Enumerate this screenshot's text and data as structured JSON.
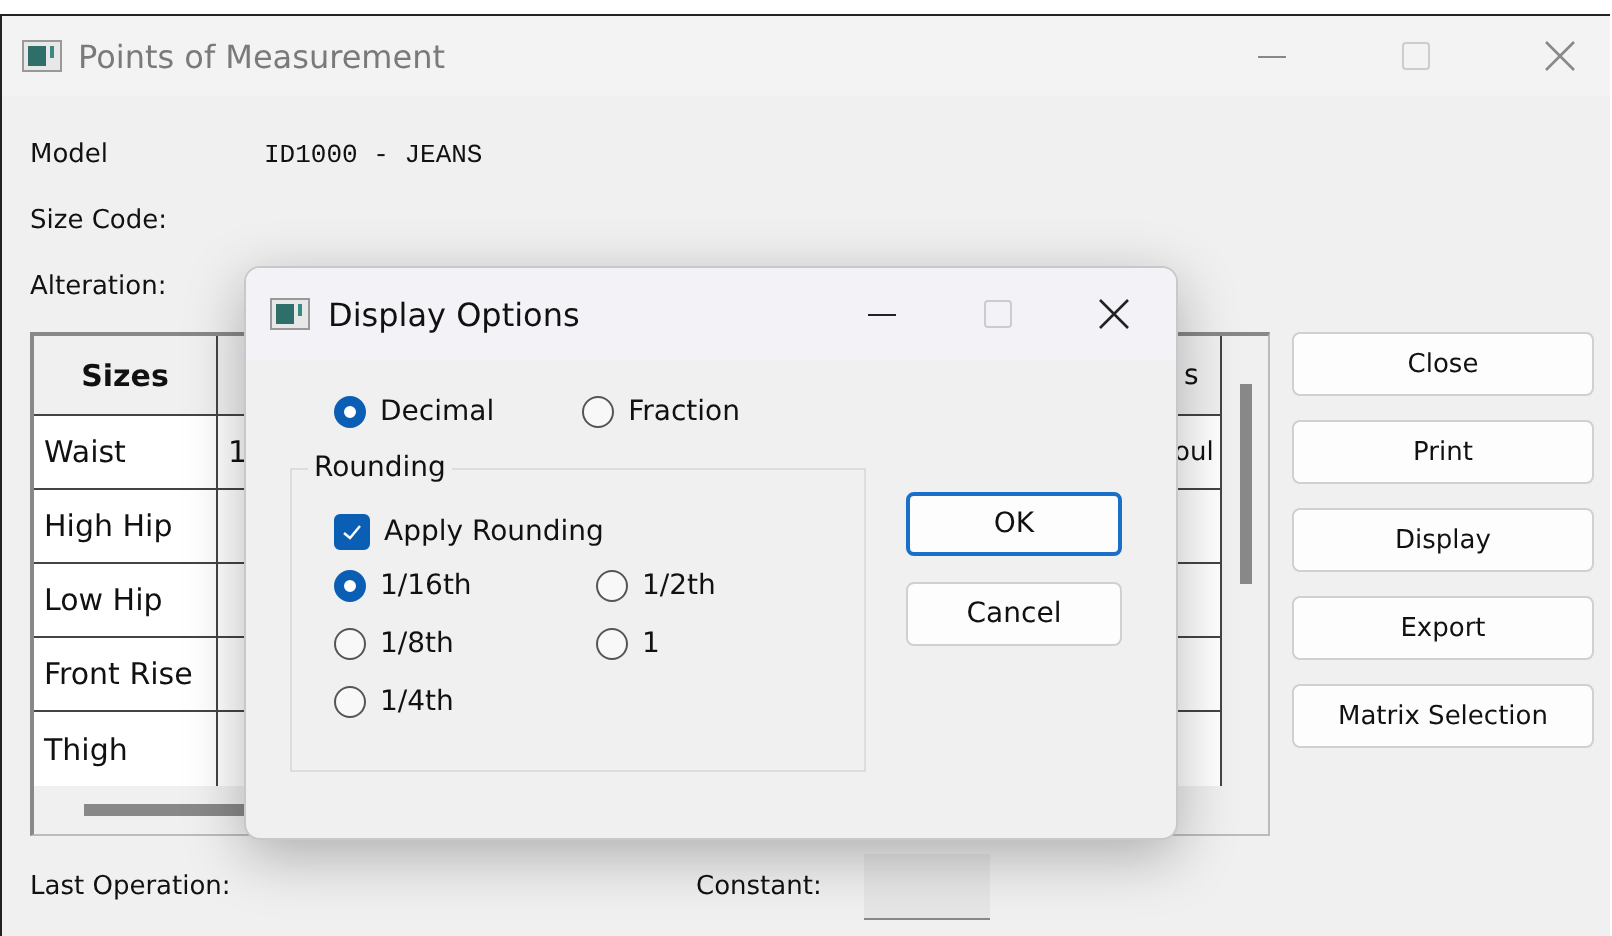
{
  "window": {
    "title": "Points of Measurement"
  },
  "fields": [
    {
      "label": "Model",
      "value": "ID1000 - JEANS"
    },
    {
      "label": "Size Code:"
    },
    {
      "label": "Alteration:"
    }
  ],
  "table": {
    "header": {
      "column_1": "Sizes",
      "column_3": "s"
    },
    "rows": [
      {
        "label": "Waist",
        "column_2": "1",
        "column_3": "oul"
      },
      {
        "label": "High Hip"
      },
      {
        "label": "Low Hip"
      },
      {
        "label": "Front Rise"
      },
      {
        "label": "Thigh"
      }
    ]
  },
  "buttons": [
    "Close",
    "Print",
    "Display",
    "Export",
    "Matrix Selection"
  ],
  "status_bar": {
    "last_operation_label": "Last Operation:",
    "constant_label": "Constant:"
  },
  "dialog": {
    "title": "Display Options",
    "format_options": [
      {
        "label": "Decimal",
        "selected": true
      },
      {
        "label": "Fraction",
        "selected": false
      }
    ],
    "rounding": {
      "title": "Rounding",
      "apply": {
        "label": "Apply Rounding",
        "checked": true
      },
      "options": [
        {
          "label": "1/16th",
          "selected": true
        },
        {
          "label": "1/2th",
          "selected": false
        },
        {
          "label": "1/8th",
          "selected": false
        },
        {
          "label": "1",
          "selected": false
        },
        {
          "label": "1/4th",
          "selected": false
        }
      ]
    },
    "buttons": [
      {
        "label": "OK",
        "default": true
      },
      {
        "label": "Cancel",
        "default": false
      }
    ]
  }
}
